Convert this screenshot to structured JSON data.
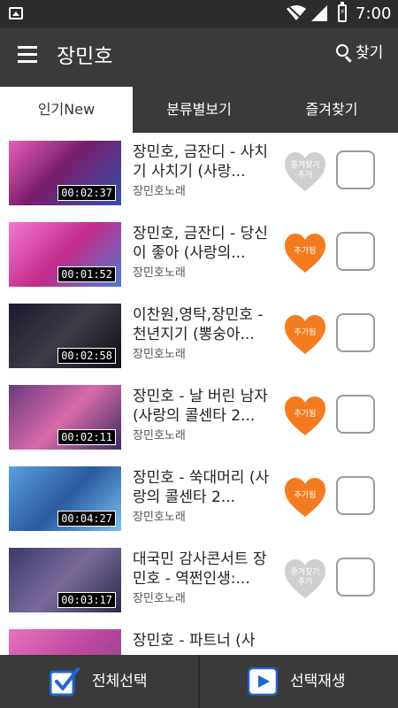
{
  "status_bar": {
    "time": "7:00",
    "battery_indicator": "⚡"
  },
  "app_bar": {
    "title": "장민호",
    "search_label": "찾기"
  },
  "tabs": [
    {
      "label": "인기New",
      "active": true
    },
    {
      "label": "분류별보기",
      "active": false
    },
    {
      "label": "즐겨찾기",
      "active": false
    }
  ],
  "videos": [
    {
      "title": "장민호, 금잔디 - 사치기 사치기 (사랑...",
      "channel": "장민호노래",
      "duration": "00:02:37",
      "favorited": false,
      "fav_label_line1": "즐겨찾기",
      "fav_label_line2": "추가"
    },
    {
      "title": "장민호, 금잔디 - 당신이 좋아 (사랑의...",
      "channel": "장민호노래",
      "duration": "00:01:52",
      "favorited": true,
      "fav_label_line1": "추가됨",
      "fav_label_line2": ""
    },
    {
      "title": "이찬원,영탁,장민호 - 천년지기 (뽕숭아...",
      "channel": "장민호노래",
      "duration": "00:02:58",
      "favorited": true,
      "fav_label_line1": "추가됨",
      "fav_label_line2": ""
    },
    {
      "title": "장민호 - 날 버린 남자 (사랑의 콜센타 2...",
      "channel": "장민호노래",
      "duration": "00:02:11",
      "favorited": true,
      "fav_label_line1": "추가됨",
      "fav_label_line2": ""
    },
    {
      "title": "장민호 - 쑥대머리 (사랑의 콜센타 2...",
      "channel": "장민호노래",
      "duration": "00:04:27",
      "favorited": true,
      "fav_label_line1": "추가됨",
      "fav_label_line2": ""
    },
    {
      "title": "대국민 감사콘서트 장민호 - 역쩐인생:...",
      "channel": "장민호노래",
      "duration": "00:03:17",
      "favorited": false,
      "fav_label_line1": "즐겨찾기",
      "fav_label_line2": "추가"
    },
    {
      "title": "장민호 - 파트너 (사",
      "channel": "",
      "duration": "",
      "favorited": false,
      "fav_label_line1": "",
      "fav_label_line2": ""
    }
  ],
  "bottom_bar": {
    "select_all_label": "전체선택",
    "play_selected_label": "선택재생"
  },
  "colors": {
    "app_bar": "#3a3a3a",
    "status_bar": "#2c2c2c",
    "heart_active": "#f47c20",
    "heart_inactive": "#cfcfcf",
    "play_icon": "#1e66d0"
  }
}
